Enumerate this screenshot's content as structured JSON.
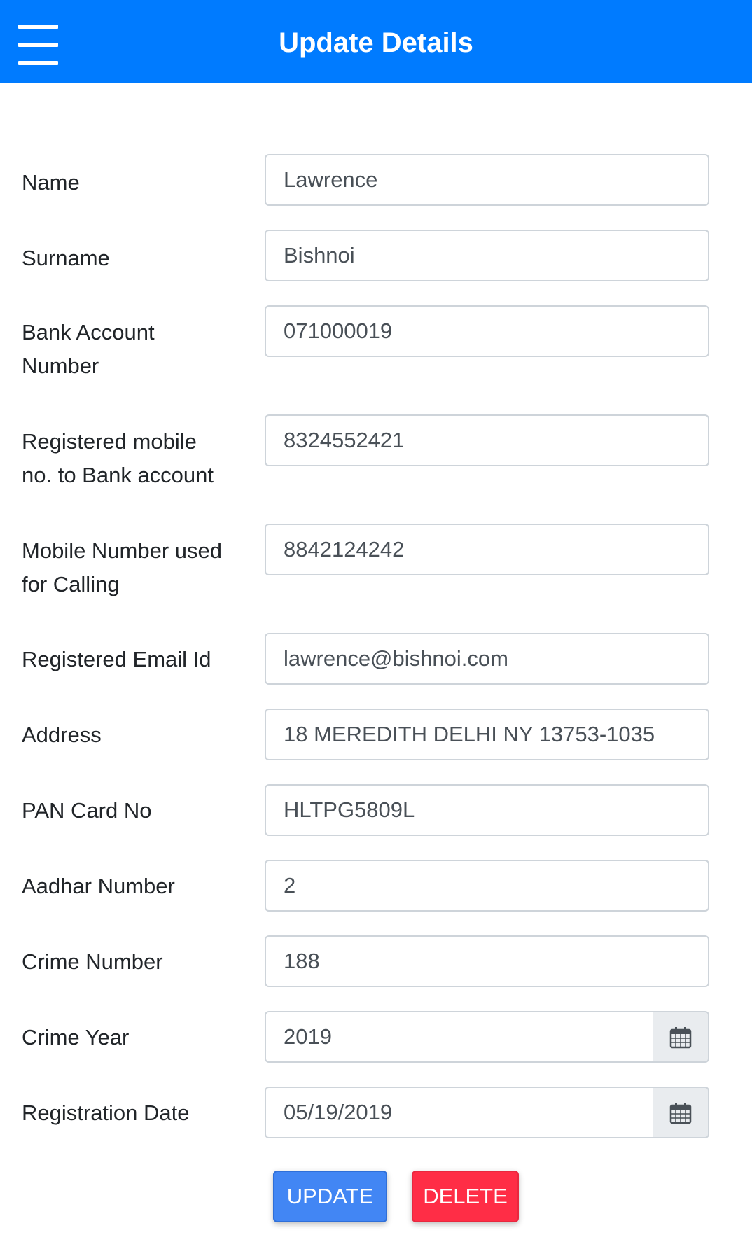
{
  "header": {
    "title": "Update Details",
    "menu_icon": "hamburger-menu-icon"
  },
  "form": {
    "fields": [
      {
        "label": "Name",
        "value": "Lawrence"
      },
      {
        "label": "Surname",
        "value": "Bishnoi"
      },
      {
        "label": "Bank Account Number",
        "value": "071000019"
      },
      {
        "label": "Registered mobile no. to Bank account",
        "value": "8324552421"
      },
      {
        "label": "Mobile Number used for Calling",
        "value": "8842124242"
      },
      {
        "label": "Registered Email Id",
        "value": "lawrence@bishnoi.com"
      },
      {
        "label": "Address",
        "value": "18 MEREDITH DELHI NY 13753-1035"
      },
      {
        "label": "PAN Card No",
        "value": "HLTPG5809L"
      },
      {
        "label": "Aadhar Number",
        "value": "2"
      },
      {
        "label": "Crime Number",
        "value": "188"
      },
      {
        "label": "Crime Year",
        "value": "2019",
        "addon_icon": "calendar-icon"
      },
      {
        "label": "Registration Date",
        "value": "05/19/2019",
        "addon_icon": "calendar-icon"
      }
    ]
  },
  "actions": {
    "update_label": "UPDATE",
    "delete_label": "DELETE"
  },
  "colors": {
    "header_bg": "#007bff",
    "update_button": "#4286f4",
    "delete_button": "#ff2d46",
    "addon_bg": "#e9ecef"
  }
}
